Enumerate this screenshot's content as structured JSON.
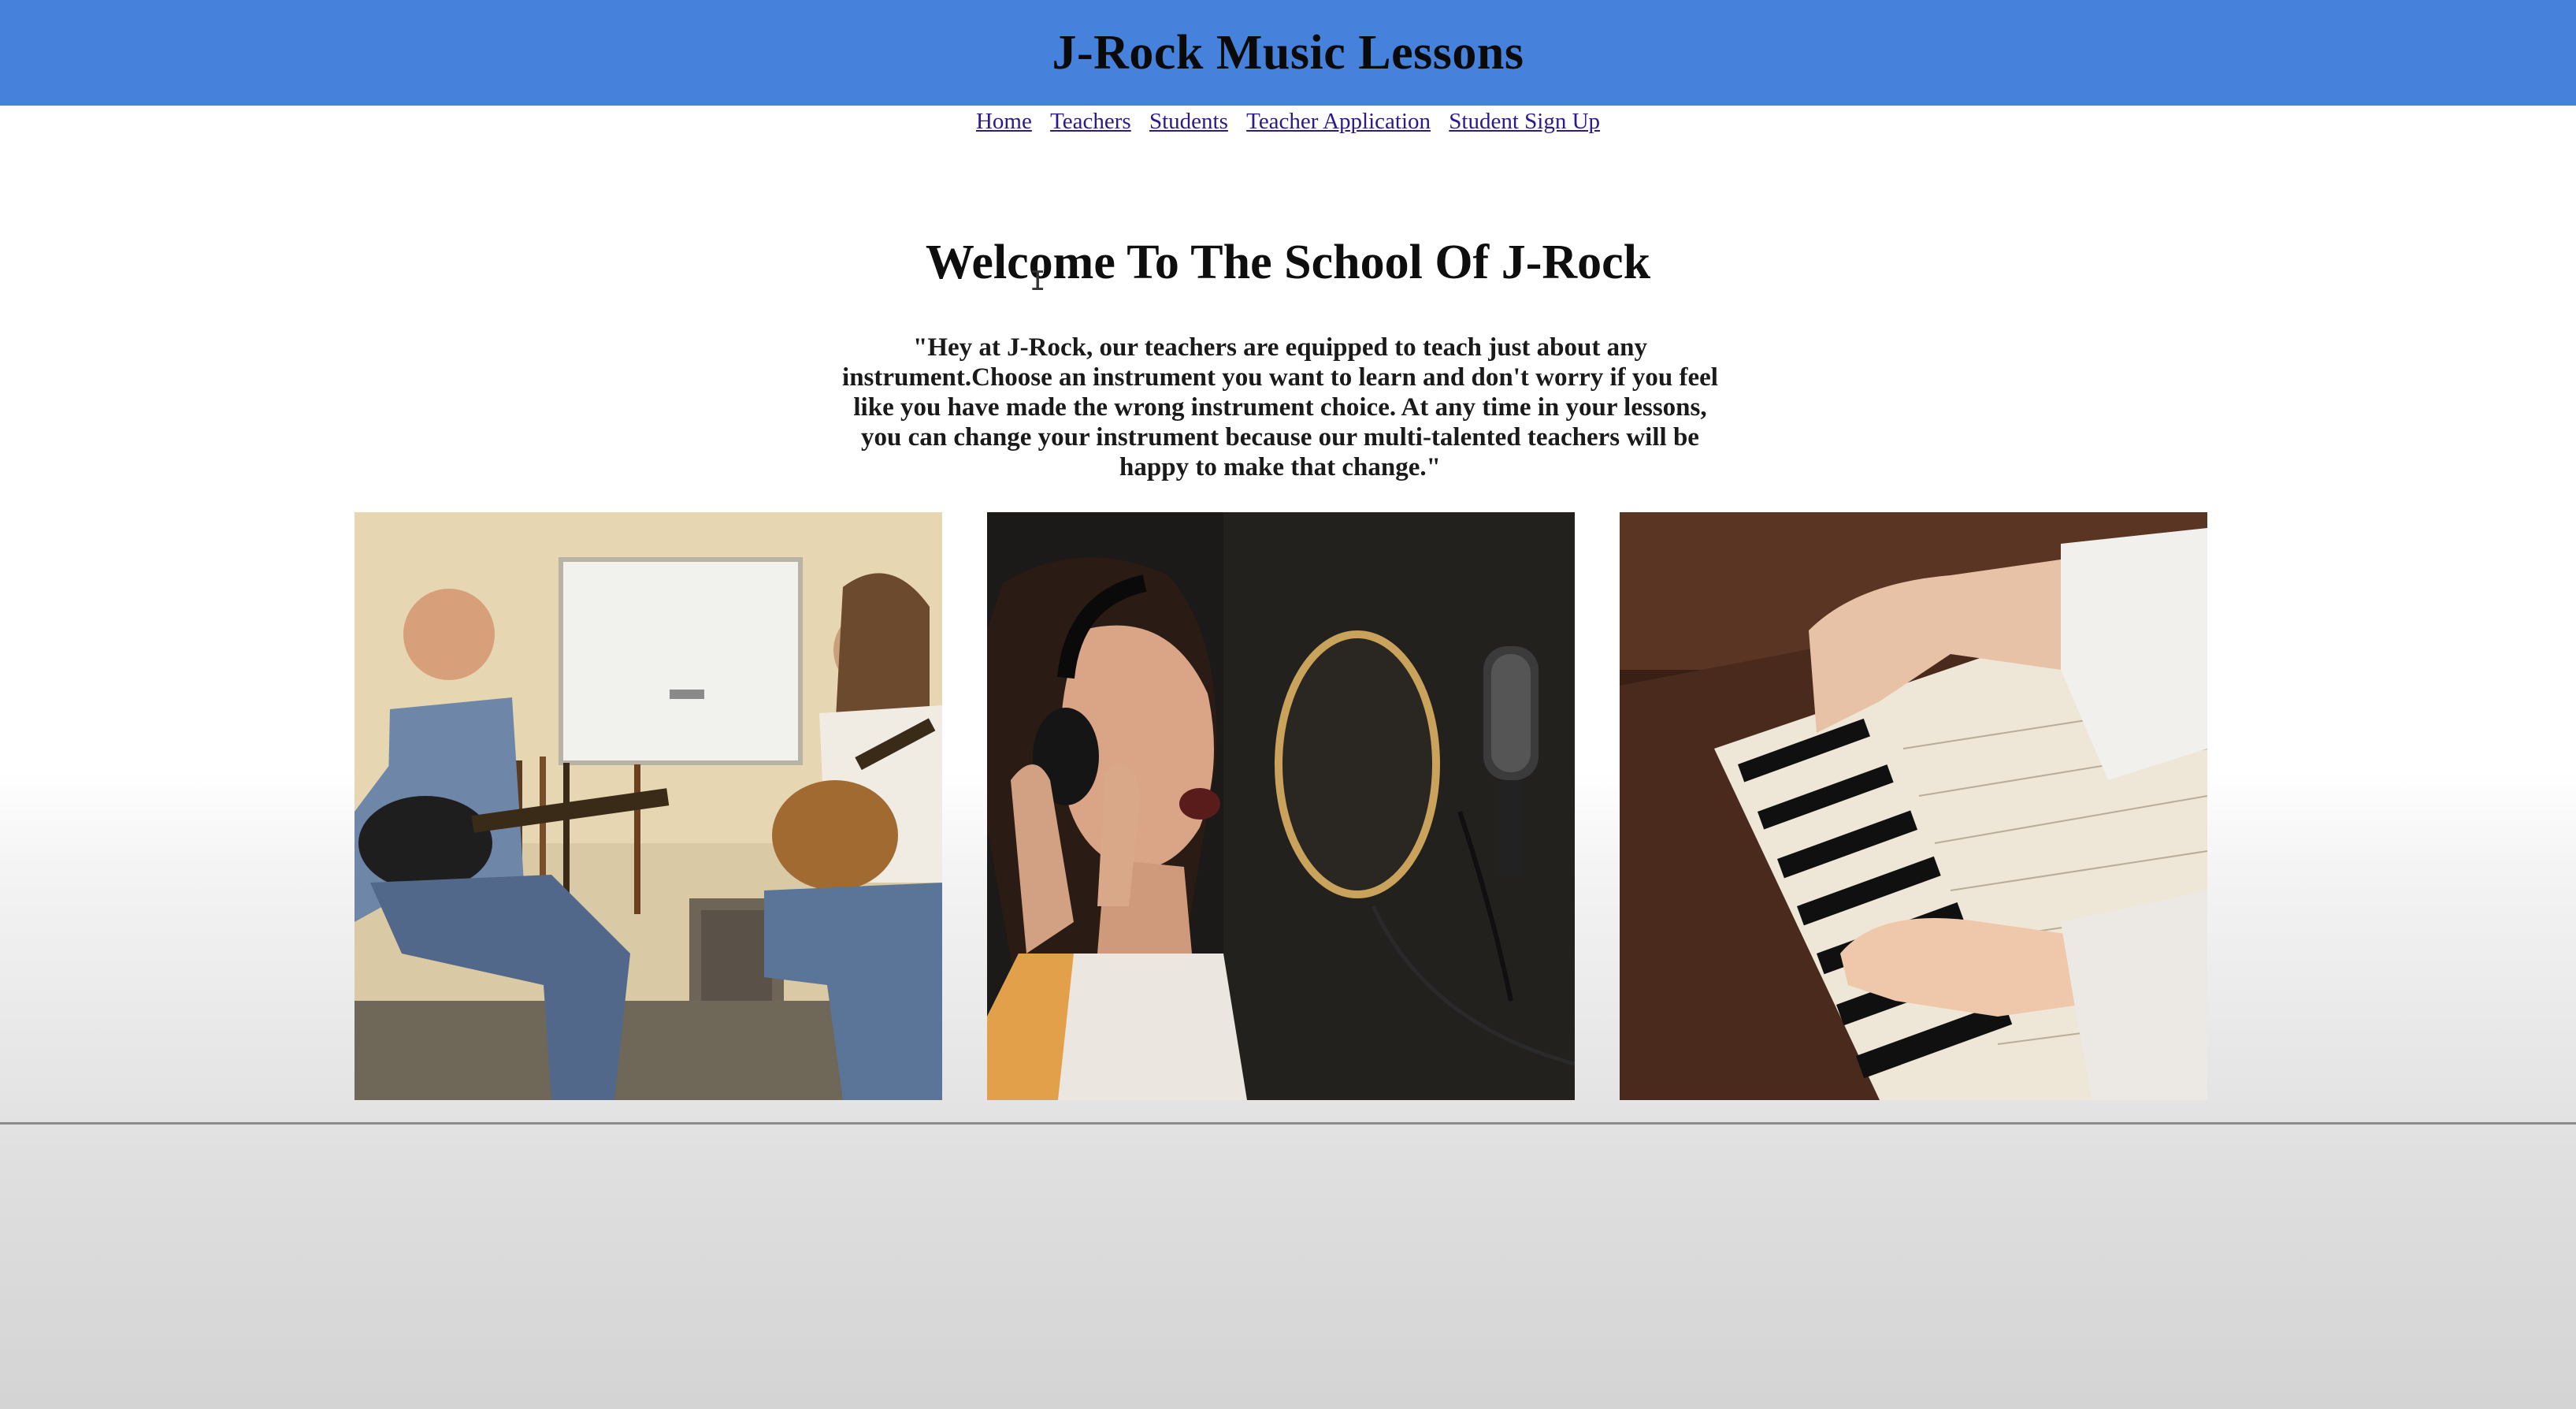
{
  "header": {
    "title": "J-Rock Music Lessons"
  },
  "nav": {
    "items": [
      {
        "label": "Home"
      },
      {
        "label": "Teachers"
      },
      {
        "label": "Students"
      },
      {
        "label": "Teacher Application"
      },
      {
        "label": "Student Sign Up"
      }
    ]
  },
  "main": {
    "heading": "Welcome To The School Of J-Rock",
    "quote": "\"Hey at J-Rock, our teachers are equipped to teach just about any instrument.Choose an instrument you want to learn and don't worry if you feel like you have made the wrong instrument choice. At any time in your lessons, you can change your instrument because our multi-talented teachers will be happy to make that change.\""
  },
  "photos": [
    {
      "subject": "guitar-lesson-photo"
    },
    {
      "subject": "singer-microphone-photo"
    },
    {
      "subject": "piano-hands-photo"
    }
  ],
  "colors": {
    "header_bg": "#4682dc",
    "link": "#2a1a8a"
  }
}
